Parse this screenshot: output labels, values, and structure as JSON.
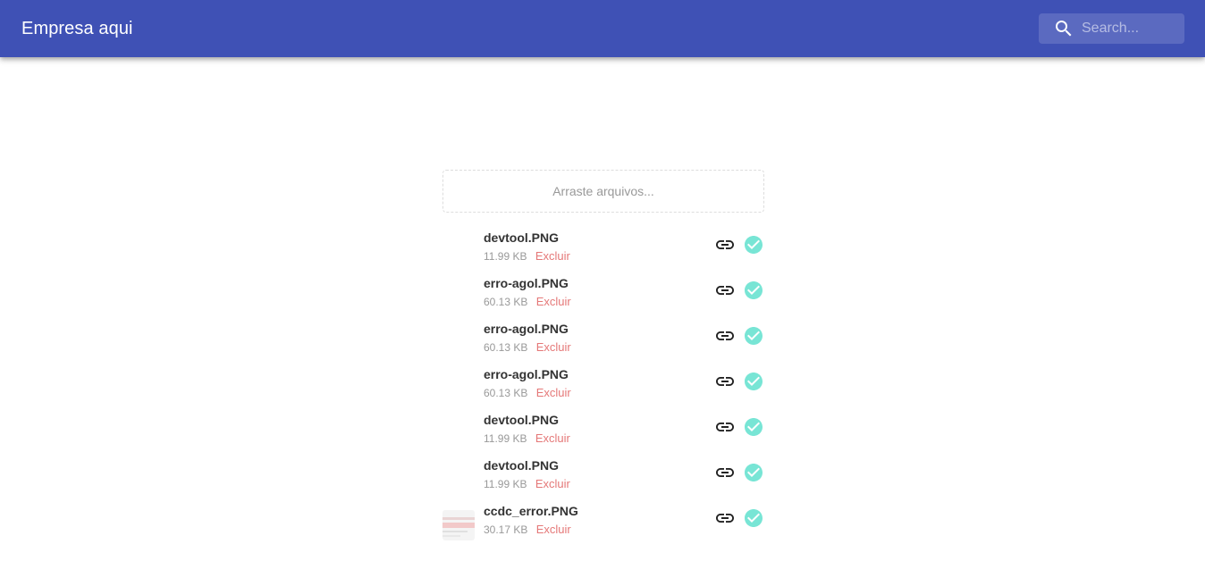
{
  "appbar": {
    "title": "Empresa aqui",
    "background_color": "#3f51b5",
    "search": {
      "icon": "search-icon",
      "placeholder": "Search..."
    }
  },
  "dropzone": {
    "label": "Arraste arquivos..."
  },
  "files": [
    {
      "name": "devtool.PNG",
      "size": "11.99 KB",
      "delete_label": "Excluir",
      "preview": false,
      "link_icon": "link-icon",
      "status_icon": "check-circle-icon",
      "status_color": "#78e5d5"
    },
    {
      "name": "erro-agol.PNG",
      "size": "60.13 KB",
      "delete_label": "Excluir",
      "preview": false,
      "link_icon": "link-icon",
      "status_icon": "check-circle-icon",
      "status_color": "#78e5d5"
    },
    {
      "name": "erro-agol.PNG",
      "size": "60.13 KB",
      "delete_label": "Excluir",
      "preview": false,
      "link_icon": "link-icon",
      "status_icon": "check-circle-icon",
      "status_color": "#78e5d5"
    },
    {
      "name": "erro-agol.PNG",
      "size": "60.13 KB",
      "delete_label": "Excluir",
      "preview": false,
      "link_icon": "link-icon",
      "status_icon": "check-circle-icon",
      "status_color": "#78e5d5"
    },
    {
      "name": "devtool.PNG",
      "size": "11.99 KB",
      "delete_label": "Excluir",
      "preview": false,
      "link_icon": "link-icon",
      "status_icon": "check-circle-icon",
      "status_color": "#78e5d5"
    },
    {
      "name": "devtool.PNG",
      "size": "11.99 KB",
      "delete_label": "Excluir",
      "preview": false,
      "link_icon": "link-icon",
      "status_icon": "check-circle-icon",
      "status_color": "#78e5d5"
    },
    {
      "name": "ccdc_error.PNG",
      "size": "30.17 KB",
      "delete_label": "Excluir",
      "preview": true,
      "link_icon": "link-icon",
      "status_icon": "check-circle-icon",
      "status_color": "#78e5d5"
    }
  ]
}
